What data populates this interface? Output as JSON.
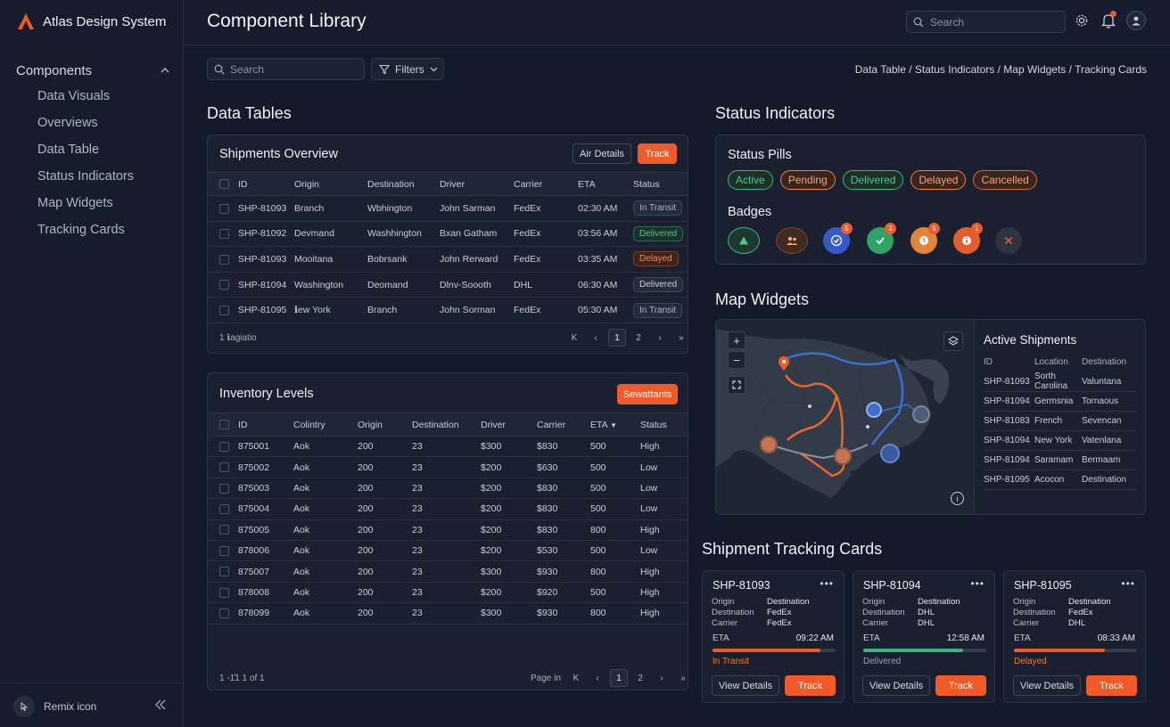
{
  "app": {
    "brand": "Atlas Design System",
    "page_title": "Component Library"
  },
  "sidebar": {
    "group_label": "Components",
    "items": [
      {
        "label": "Data Visuals"
      },
      {
        "label": "Overviews"
      },
      {
        "label": "Data Table"
      },
      {
        "label": "Status Indicators"
      },
      {
        "label": "Map Widgets"
      },
      {
        "label": "Tracking Cards"
      }
    ],
    "footer_label": "Remix icon"
  },
  "topbar": {
    "search_placeholder": "Search"
  },
  "toolbar": {
    "search_placeholder": "Search",
    "filters_label": "Filters",
    "breadcrumb": "Data Table / Status Indicators / Map Widgets / Tracking Cards"
  },
  "data_tables": {
    "section_title": "Data Tables",
    "shipments": {
      "title": "Shipments Overview",
      "btn_details": "Air Details",
      "btn_track": "Track",
      "columns": [
        "ID",
        "Origin",
        "Destination",
        "Driver",
        "Carrier",
        "ETA",
        "Status"
      ],
      "rows": [
        {
          "id": "SHP-81093",
          "origin": "Branch",
          "destination": "Wbhington",
          "driver": "John Sarman",
          "carrier": "FedEx",
          "eta": "02:30 AM",
          "status": "In Transit",
          "kind": "transit"
        },
        {
          "id": "SHP-81092",
          "origin": "Devmand",
          "destination": "Washhington",
          "driver": "Bxan Gatham",
          "carrier": "FedEx",
          "eta": "03:56 AM",
          "status": "Delivered",
          "kind": "delivered"
        },
        {
          "id": "SHP-81093",
          "origin": "Mooitana",
          "destination": "Bobrsank",
          "driver": "John Rerward",
          "carrier": "FedEx",
          "eta": "03:35 AM",
          "status": "Delayed",
          "kind": "delayed"
        },
        {
          "id": "SHP-81094",
          "origin": "Washington",
          "destination": "Deomand",
          "driver": "Dlnv-Soooth",
          "carrier": "DHL",
          "eta": "06:30 AM",
          "status": "Delivered",
          "kind": "delivered2"
        },
        {
          "id": "SHP-81095",
          "origin": "ℹew York",
          "destination": "Branch",
          "driver": "John Sorman",
          "carrier": "FedEx",
          "eta": "05:30 AM",
          "status": "In Transit",
          "kind": "transit"
        }
      ],
      "footer": "1 ℹagiatio",
      "pages": [
        "1",
        "2"
      ]
    },
    "inventory": {
      "title": "Inventory Levels",
      "btn_action": "Sewattants",
      "columns": [
        "ID",
        "Colintry",
        "Origin",
        "Destination",
        "Driver",
        "Carrier",
        "ETA",
        "Status"
      ],
      "rows": [
        {
          "id": "875001",
          "country": "Aok",
          "origin": "200",
          "destination": "23",
          "driver": "$300",
          "carrier": "$830",
          "eta": "500",
          "status": "High"
        },
        {
          "id": "875002",
          "country": "Aok",
          "origin": "200",
          "destination": "23",
          "driver": "$200",
          "carrier": "$630",
          "eta": "500",
          "status": "Low"
        },
        {
          "id": "875003",
          "country": "Aok",
          "origin": "200",
          "destination": "23",
          "driver": "$200",
          "carrier": "$830",
          "eta": "500",
          "status": "Low"
        },
        {
          "id": "875004",
          "country": "Aok",
          "origin": "200",
          "destination": "23",
          "driver": "$200",
          "carrier": "$830",
          "eta": "500",
          "status": "Low"
        },
        {
          "id": "875005",
          "country": "Aok",
          "origin": "200",
          "destination": "23",
          "driver": "$200",
          "carrier": "$830",
          "eta": "800",
          "status": "High"
        },
        {
          "id": "878006",
          "country": "Aok",
          "origin": "200",
          "destination": "23",
          "driver": "$200",
          "carrier": "$530",
          "eta": "500",
          "status": "Low"
        },
        {
          "id": "875007",
          "country": "Aok",
          "origin": "200",
          "destination": "23",
          "driver": "$300",
          "carrier": "$930",
          "eta": "800",
          "status": "High"
        },
        {
          "id": "878008",
          "country": "Aok",
          "origin": "200",
          "destination": "23",
          "driver": "$200",
          "carrier": "$920",
          "eta": "500",
          "status": "High"
        },
        {
          "id": "878099",
          "country": "Aok",
          "origin": "200",
          "destination": "23",
          "driver": "$300",
          "carrier": "$930",
          "eta": "800",
          "status": "High"
        }
      ],
      "footer": "1 -1̄1 1 of 1",
      "page_label": "Page in",
      "pages": [
        "1",
        "2"
      ]
    }
  },
  "status_indicators": {
    "section_title": "Status Indicators",
    "pills_title": "Status Pills",
    "pills": [
      {
        "label": "Active",
        "color": "#3fb37f"
      },
      {
        "label": "Pending",
        "color": "#f0843c"
      },
      {
        "label": "Delivered",
        "color": "#3fb37f"
      },
      {
        "label": "Delayed",
        "color": "#f0843c"
      },
      {
        "label": "Cancelled",
        "color": "#d0683a"
      }
    ],
    "badges_title": "Badges",
    "badges": [
      {
        "icon": "triangle-icon",
        "count": ""
      },
      {
        "icon": "users-icon",
        "count": ""
      },
      {
        "icon": "check-circle-icon",
        "count": "5"
      },
      {
        "icon": "check-icon",
        "count": "3"
      },
      {
        "icon": "clock-icon",
        "count": "5"
      },
      {
        "icon": "info-icon",
        "count": "1"
      },
      {
        "icon": "close-icon",
        "count": ""
      }
    ]
  },
  "map_widgets": {
    "section_title": "Map Widgets",
    "panel_title": "Active Shipments",
    "columns": [
      "ID",
      "Location",
      "Destination"
    ],
    "rows": [
      {
        "id": "SHP-81093",
        "location": "Sorth Carolina",
        "destination": "Valuntana"
      },
      {
        "id": "SHP-81094",
        "location": "Germsnia",
        "destination": "Tornaous"
      },
      {
        "id": "SHP-81083",
        "location": "French",
        "destination": "Sevencan"
      },
      {
        "id": "SHP-81094",
        "location": "New York",
        "destination": "Vatenlana"
      },
      {
        "id": "SHP-81094",
        "location": "Saramam",
        "destination": "Bermaam"
      },
      {
        "id": "SHP-81095",
        "location": "Acocon",
        "destination": "Destination"
      }
    ]
  },
  "tracking": {
    "section_title": "Shipment Tracking Cards",
    "labels": {
      "origin": "Origin",
      "destination": "Destination",
      "carrier": "Carrier",
      "eta": "ETA",
      "view": "View Details",
      "track": "Track"
    },
    "cards": [
      {
        "id": "SHP-81093",
        "v1": "Destination",
        "v2": "FedEx",
        "v3": "FedEx",
        "time": "09:22 AM",
        "progress": 0.88,
        "status": "In Transit",
        "color": "#f05a28"
      },
      {
        "id": "SHP-81094",
        "v1": "Destination",
        "v2": "DHL",
        "v3": "DHL",
        "time": "12:58 AM",
        "progress": 0.81,
        "status": "Delivered",
        "color": "#3fb37f"
      },
      {
        "id": "SHP-81095",
        "v1": "Destination",
        "v2": "FedEx",
        "v3": "DHL",
        "time": "08:33 AM",
        "progress": 0.74,
        "status": "Delayed",
        "color": "#f05a28"
      }
    ]
  }
}
